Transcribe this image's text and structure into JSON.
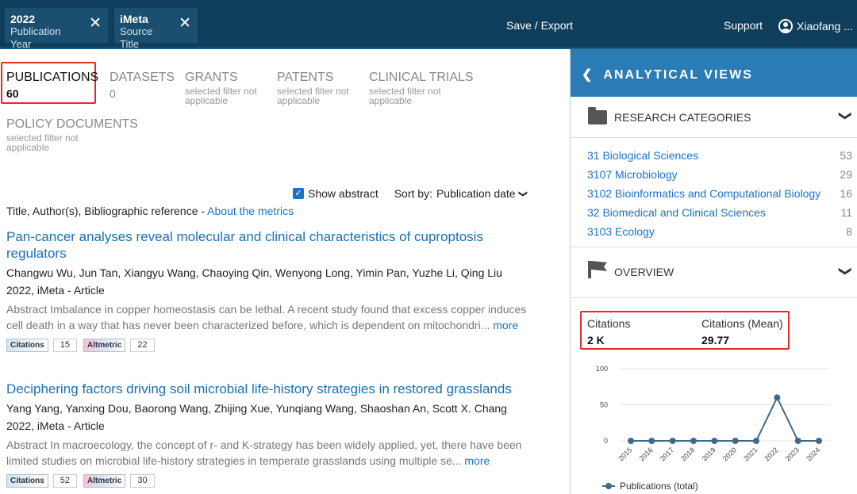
{
  "filters": [
    {
      "title": "2022",
      "subtitle": "Publication Year",
      "close": "✕"
    },
    {
      "title": "iMeta",
      "subtitle": "Source Title",
      "close": "✕"
    }
  ],
  "top": {
    "save_export": "Save / Export",
    "support": "Support",
    "user": "Xiaofang ..."
  },
  "tabs": {
    "publications": {
      "label": "PUBLICATIONS",
      "value": "60"
    },
    "datasets": {
      "label": "DATASETS",
      "value": "0"
    },
    "grants": {
      "label": "GRANTS",
      "note": "selected filter not applicable"
    },
    "patents": {
      "label": "PATENTS",
      "note": "selected filter not applicable"
    },
    "clinical_trials": {
      "label": "CLINICAL TRIALS",
      "note": "selected filter not applicable"
    },
    "policy": {
      "label": "POLICY DOCUMENTS",
      "note": "selected filter not applicable"
    }
  },
  "controls": {
    "show_abstract": "Show abstract",
    "sort_label": "Sort by:",
    "sort_value": "Publication date",
    "checkmark": "✓",
    "chevron": "❯"
  },
  "list_header": {
    "text": "Title, Author(s), Bibliographic reference - ",
    "link": "About the metrics"
  },
  "results": [
    {
      "title": "Pan-cancer analyses reveal molecular and clinical characteristics of cuproptosis regulators",
      "authors": "Changwu Wu, Jun Tan, Xiangyu Wang, Chaoying Qin, Wenyong Long, Yimin Pan, Yuzhe Li, Qing Liu",
      "source": "2022, iMeta - Article",
      "abstract": "Abstract Imbalance in copper homeostasis can be lethal. A recent study found that excess copper induces cell death in a way that has never been characterized before, which is dependent on mitochondri...",
      "more": "more",
      "citations_label": "Citations",
      "citations": "15",
      "altmetric_label": "Altmetric",
      "altmetric": "22"
    },
    {
      "title": "Deciphering factors driving soil microbial life-history strategies in restored grasslands",
      "authors": "Yang Yang, Yanxing Dou, Baorong Wang, Zhijing Xue, Yunqiang Wang, Shaoshan An, Scott X. Chang",
      "source": "2022, iMeta - Article",
      "abstract": "Abstract In macroecology, the concept of r- and K-strategy has been widely applied, yet, there have been limited studies on microbial life-history strategies in temperate grasslands using multiple se...",
      "more": "more",
      "citations_label": "Citations",
      "citations": "52",
      "altmetric_label": "Altmetric",
      "altmetric": "30"
    }
  ],
  "panel": {
    "title": "ANALYTICAL VIEWS",
    "back": "❮",
    "research_categories": "RESEARCH CATEGORIES",
    "overview": "OVERVIEW",
    "chevron": "❯",
    "categories": [
      {
        "name": "31 Biological Sciences",
        "count": "53"
      },
      {
        "name": "3107 Microbiology",
        "count": "29"
      },
      {
        "name": "3102 Bioinformatics and Computational Biology",
        "count": "16"
      },
      {
        "name": "32 Biomedical and Clinical Sciences",
        "count": "11"
      },
      {
        "name": "3103 Ecology",
        "count": "8"
      }
    ],
    "stats": [
      {
        "label": "Citations",
        "value": "2 K"
      },
      {
        "label": "Citations (Mean)",
        "value": "29.77"
      }
    ]
  },
  "chart_data": {
    "type": "line",
    "x": [
      "2015",
      "2016",
      "2017",
      "2018",
      "2019",
      "2020",
      "2021",
      "2022",
      "2023",
      "2024"
    ],
    "series": [
      {
        "name": "Publications (total)",
        "values": [
          0,
          0,
          0,
          0,
          0,
          0,
          0,
          60,
          0,
          0
        ]
      }
    ],
    "yticks": [
      "0",
      "50",
      "100"
    ],
    "ylim": [
      0,
      100
    ],
    "grid": true,
    "legend": "bottom",
    "color": "#3d6b8a"
  }
}
